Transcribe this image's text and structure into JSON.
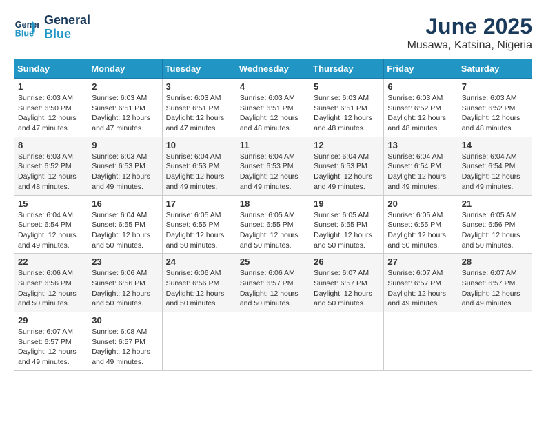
{
  "header": {
    "logo_line1": "General",
    "logo_line2": "Blue",
    "month": "June 2025",
    "location": "Musawa, Katsina, Nigeria"
  },
  "weekdays": [
    "Sunday",
    "Monday",
    "Tuesday",
    "Wednesday",
    "Thursday",
    "Friday",
    "Saturday"
  ],
  "weeks": [
    [
      {
        "day": "1",
        "sunrise": "6:03 AM",
        "sunset": "6:50 PM",
        "daylight": "12 hours and 47 minutes."
      },
      {
        "day": "2",
        "sunrise": "6:03 AM",
        "sunset": "6:51 PM",
        "daylight": "12 hours and 47 minutes."
      },
      {
        "day": "3",
        "sunrise": "6:03 AM",
        "sunset": "6:51 PM",
        "daylight": "12 hours and 47 minutes."
      },
      {
        "day": "4",
        "sunrise": "6:03 AM",
        "sunset": "6:51 PM",
        "daylight": "12 hours and 48 minutes."
      },
      {
        "day": "5",
        "sunrise": "6:03 AM",
        "sunset": "6:51 PM",
        "daylight": "12 hours and 48 minutes."
      },
      {
        "day": "6",
        "sunrise": "6:03 AM",
        "sunset": "6:52 PM",
        "daylight": "12 hours and 48 minutes."
      },
      {
        "day": "7",
        "sunrise": "6:03 AM",
        "sunset": "6:52 PM",
        "daylight": "12 hours and 48 minutes."
      }
    ],
    [
      {
        "day": "8",
        "sunrise": "6:03 AM",
        "sunset": "6:52 PM",
        "daylight": "12 hours and 48 minutes."
      },
      {
        "day": "9",
        "sunrise": "6:03 AM",
        "sunset": "6:53 PM",
        "daylight": "12 hours and 49 minutes."
      },
      {
        "day": "10",
        "sunrise": "6:04 AM",
        "sunset": "6:53 PM",
        "daylight": "12 hours and 49 minutes."
      },
      {
        "day": "11",
        "sunrise": "6:04 AM",
        "sunset": "6:53 PM",
        "daylight": "12 hours and 49 minutes."
      },
      {
        "day": "12",
        "sunrise": "6:04 AM",
        "sunset": "6:53 PM",
        "daylight": "12 hours and 49 minutes."
      },
      {
        "day": "13",
        "sunrise": "6:04 AM",
        "sunset": "6:54 PM",
        "daylight": "12 hours and 49 minutes."
      },
      {
        "day": "14",
        "sunrise": "6:04 AM",
        "sunset": "6:54 PM",
        "daylight": "12 hours and 49 minutes."
      }
    ],
    [
      {
        "day": "15",
        "sunrise": "6:04 AM",
        "sunset": "6:54 PM",
        "daylight": "12 hours and 49 minutes."
      },
      {
        "day": "16",
        "sunrise": "6:04 AM",
        "sunset": "6:55 PM",
        "daylight": "12 hours and 50 minutes."
      },
      {
        "day": "17",
        "sunrise": "6:05 AM",
        "sunset": "6:55 PM",
        "daylight": "12 hours and 50 minutes."
      },
      {
        "day": "18",
        "sunrise": "6:05 AM",
        "sunset": "6:55 PM",
        "daylight": "12 hours and 50 minutes."
      },
      {
        "day": "19",
        "sunrise": "6:05 AM",
        "sunset": "6:55 PM",
        "daylight": "12 hours and 50 minutes."
      },
      {
        "day": "20",
        "sunrise": "6:05 AM",
        "sunset": "6:55 PM",
        "daylight": "12 hours and 50 minutes."
      },
      {
        "day": "21",
        "sunrise": "6:05 AM",
        "sunset": "6:56 PM",
        "daylight": "12 hours and 50 minutes."
      }
    ],
    [
      {
        "day": "22",
        "sunrise": "6:06 AM",
        "sunset": "6:56 PM",
        "daylight": "12 hours and 50 minutes."
      },
      {
        "day": "23",
        "sunrise": "6:06 AM",
        "sunset": "6:56 PM",
        "daylight": "12 hours and 50 minutes."
      },
      {
        "day": "24",
        "sunrise": "6:06 AM",
        "sunset": "6:56 PM",
        "daylight": "12 hours and 50 minutes."
      },
      {
        "day": "25",
        "sunrise": "6:06 AM",
        "sunset": "6:57 PM",
        "daylight": "12 hours and 50 minutes."
      },
      {
        "day": "26",
        "sunrise": "6:07 AM",
        "sunset": "6:57 PM",
        "daylight": "12 hours and 50 minutes."
      },
      {
        "day": "27",
        "sunrise": "6:07 AM",
        "sunset": "6:57 PM",
        "daylight": "12 hours and 49 minutes."
      },
      {
        "day": "28",
        "sunrise": "6:07 AM",
        "sunset": "6:57 PM",
        "daylight": "12 hours and 49 minutes."
      }
    ],
    [
      {
        "day": "29",
        "sunrise": "6:07 AM",
        "sunset": "6:57 PM",
        "daylight": "12 hours and 49 minutes."
      },
      {
        "day": "30",
        "sunrise": "6:08 AM",
        "sunset": "6:57 PM",
        "daylight": "12 hours and 49 minutes."
      },
      null,
      null,
      null,
      null,
      null
    ]
  ],
  "labels": {
    "sunrise": "Sunrise:",
    "sunset": "Sunset:",
    "daylight": "Daylight:"
  }
}
